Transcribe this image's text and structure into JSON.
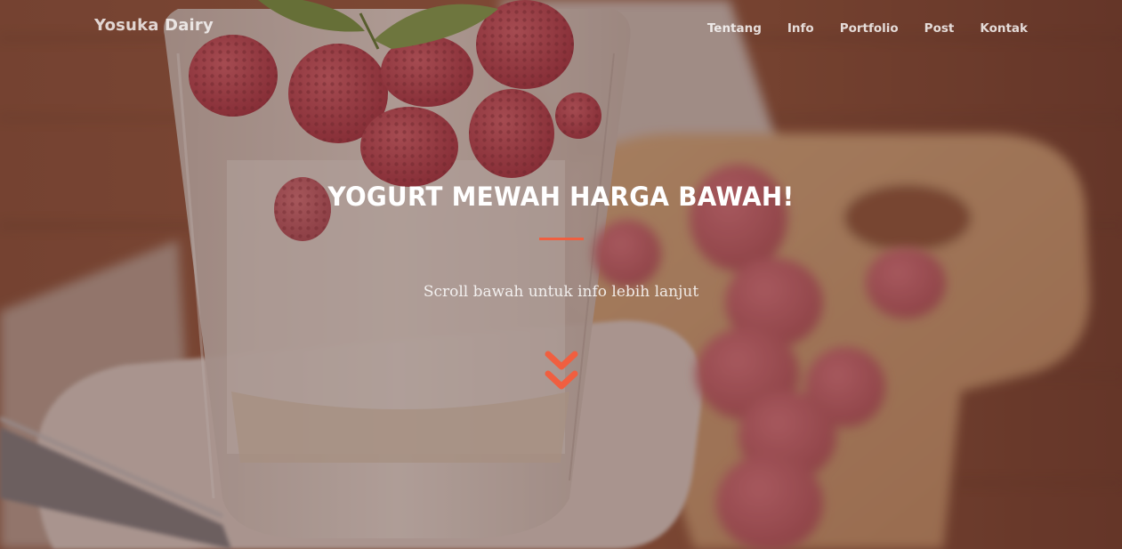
{
  "navbar": {
    "brand": "Yosuka Dairy",
    "links": [
      {
        "label": "Tentang"
      },
      {
        "label": "Info"
      },
      {
        "label": "Portfolio"
      },
      {
        "label": "Post"
      },
      {
        "label": "Kontak"
      }
    ]
  },
  "hero": {
    "heading": "YOGURT MEWAH HARGA BAWAH!",
    "subtitle": "Scroll bawah untuk info lebih lanjut",
    "scroll_icon": "double-chevron-down-icon"
  },
  "colors": {
    "accent": "#f05f40",
    "overlay": "#5c3a30"
  }
}
